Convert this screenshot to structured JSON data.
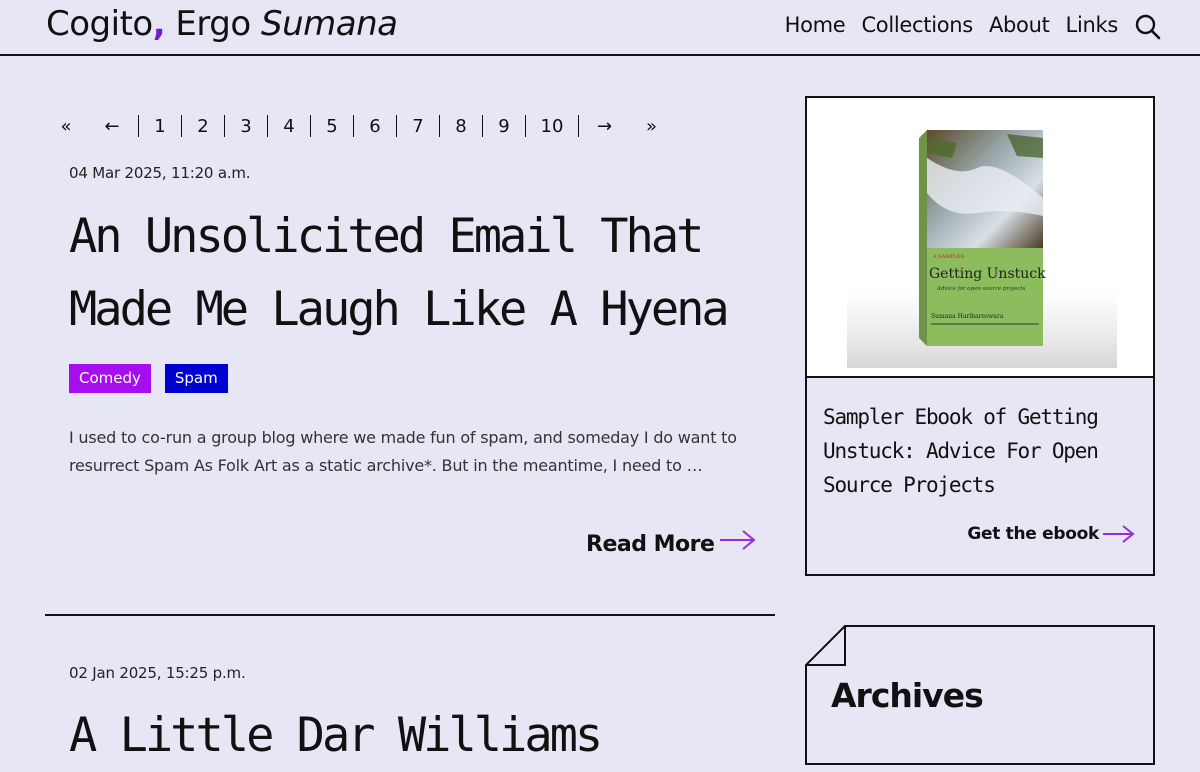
{
  "site": {
    "title_part1": "Cogito",
    "title_comma": ",",
    "title_part2": " Ergo ",
    "title_part3": "Sumana"
  },
  "nav": {
    "items": [
      "Home",
      "Collections",
      "About",
      "Links"
    ],
    "search_icon": "search-icon"
  },
  "pagination": {
    "first": "«",
    "prev": "←",
    "pages": [
      "1",
      "2",
      "3",
      "4",
      "5",
      "6",
      "7",
      "8",
      "9",
      "10"
    ],
    "next": "→",
    "last": "»"
  },
  "posts": [
    {
      "date": "04 Mar 2025, 11:20 a.m.",
      "title": "An Unsolicited Email That Made Me Laugh Like A Hyena",
      "tags": [
        {
          "label": "Comedy",
          "color": "#a60ef0"
        },
        {
          "label": "Spam",
          "color": "#0000d0"
        }
      ],
      "excerpt": "I used to co-run a group blog where we made fun of spam, and someday I do want to resurrect Spam As Folk Art as a static archive*. But in the meantime, I need to …",
      "read_more": "Read More"
    },
    {
      "date": "02 Jan 2025, 15:25 p.m.",
      "title": "A Little Dar Williams"
    }
  ],
  "sidebar": {
    "ebook": {
      "cover_series": "A SAMPLER",
      "cover_title": "Getting Unstuck",
      "cover_subtitle": "Advice for open source projects",
      "cover_author": "Sumana Harihareswara",
      "caption": "Sampler Ebook of Getting Unstuck: Advice For Open Source Projects",
      "link": "Get the ebook"
    },
    "archives_title": "Archives"
  },
  "colors": {
    "background": "#e6e6f4",
    "accent": "#7b18d8",
    "arrow": "#9b2bd8"
  }
}
